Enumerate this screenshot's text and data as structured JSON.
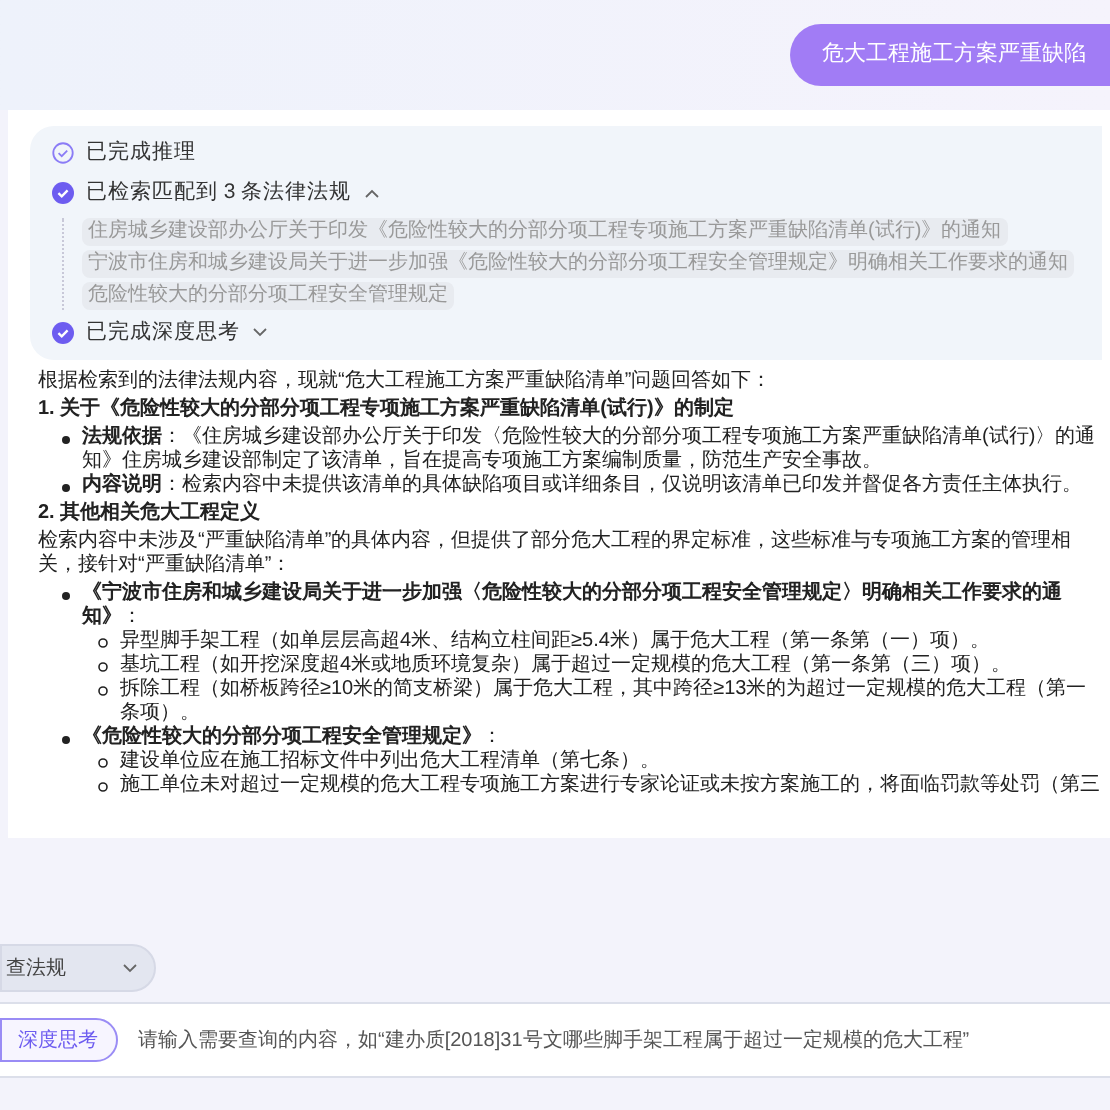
{
  "user_message": "危大工程施工方案严重缺陷",
  "steps": [
    {
      "kind": "outline",
      "label": "已完成推理"
    },
    {
      "kind": "filled",
      "label": "已检索匹配到 3 条法律法规",
      "expanded": true,
      "sources": [
        "住房城乡建设部办公厅关于印发《危险性较大的分部分项工程专项施工方案严重缺陷清单(试行)》的通知",
        "宁波市住房和城乡建设局关于进一步加强《危险性较大的分部分项工程安全管理规定》明确相关工作要求的通知",
        "危险性较大的分部分项工程安全管理规定"
      ]
    },
    {
      "kind": "filled",
      "label": "已完成深度思考",
      "expanded": false
    }
  ],
  "answer": [
    {
      "kind": "p",
      "text": "根据检索到的法律法规内容，现就“危大工程施工方案严重缺陷清单”问题回答如下："
    },
    {
      "kind": "h",
      "text": "1. 关于《危险性较大的分部分项工程专项施工方案严重缺陷清单(试行)》的制定"
    },
    {
      "kind": "ul",
      "items": [
        {
          "text": "**法规依据**：《住房城乡建设部办公厅关于印发〈危险性较大的分部分项工程专项施工方案严重缺陷清单(试行)〉的通知》住房城乡建设部制定了该清单，旨在提高专项施工方案编制质量，防范生产安全事故。"
        },
        {
          "text": "**内容说明**：检索内容中未提供该清单的具体缺陷项目或详细条目，仅说明该清单已印发并督促各方责任主体执行。"
        }
      ]
    },
    {
      "kind": "h",
      "text": "2. 其他相关危大工程定义"
    },
    {
      "kind": "p",
      "text": "检索内容中未涉及“严重缺陷清单”的具体内容，但提供了部分危大工程的界定标准，这些标准与专项施工方案的管理相关，接针对“严重缺陷清单”："
    },
    {
      "kind": "ul",
      "items": [
        {
          "text": "**《宁波市住房和城乡建设局关于进一步加强〈危险性较大的分部分项工程安全管理规定〉明确相关工作要求的通知》**：",
          "children": [
            "异型脚手架工程（如单层层高超4米、结构立柱间距≥5.4米）属于危大工程（第一条第（一）项）。",
            "基坑工程（如开挖深度超4米或地质环境复杂）属于超过一定规模的危大工程（第一条第（三）项）。",
            "拆除工程（如桥板跨径≥10米的简支桥梁）属于危大工程，其中跨径≥13米的为超过一定规模的危大工程（第一条项）。"
          ]
        },
        {
          "text": "**《危险性较大的分部分项工程安全管理规定》**：",
          "children": [
            "建设单位应在施工招标文件中列出危大工程清单（第七条）。",
            "施工单位未对超过一定规模的危大工程专项施工方案进行专家论证或未按方案施工的，将面临罚款等处罚（第三"
          ]
        }
      ]
    }
  ],
  "mode_select": "查法规",
  "deep_think": {
    "label": "深度思考",
    "selected": true
  },
  "input": {
    "placeholder": "请输入需要查询的内容，如“建办质[2018]31号文哪些脚手架工程属于超过一定规模的危大工程”"
  }
}
